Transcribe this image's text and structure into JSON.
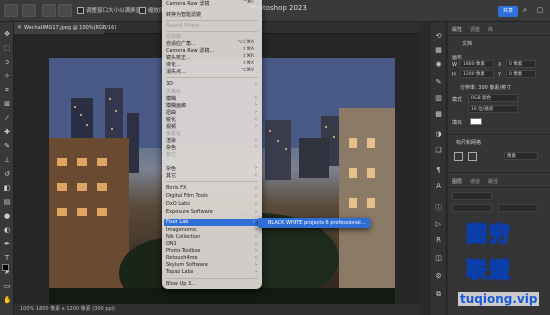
{
  "app": {
    "title": "Photoshop 2023"
  },
  "top_options": {
    "opt1": "调整窗口大小以满屏显示",
    "opt2": "缩放所有窗口",
    "share": "共享"
  },
  "document": {
    "tab": "WechatIMG17.jpeg @ 100%(RGB/16)",
    "status": "100%     1800 像素 x 1200 像素 (300 ppi)"
  },
  "filter_menu": {
    "items": [
      {
        "label": "Camera Raw 滤镜",
        "shortcut": "^⌘F"
      },
      {
        "label": "转换为智能滤镜"
      },
      {
        "label": "Neural Filters...",
        "disabled": true
      },
      {
        "label": "滤镜库...",
        "disabled": true
      },
      {
        "label": "自适应广角...",
        "shortcut": "⌥⇧⌘A"
      },
      {
        "label": "Camera Raw 滤镜...",
        "shortcut": "⇧⌘A"
      },
      {
        "label": "镜头校正...",
        "shortcut": "⇧⌘R"
      },
      {
        "label": "液化...",
        "shortcut": "⇧⌘X"
      },
      {
        "label": "消失点...",
        "shortcut": "⌥⌘V"
      },
      {
        "label": "3D"
      },
      {
        "label": "风格化",
        "disabled": true
      },
      {
        "label": "模糊"
      },
      {
        "label": "模糊画廊"
      },
      {
        "label": "扭曲"
      },
      {
        "label": "锐化"
      },
      {
        "label": "视频"
      },
      {
        "label": "像素化",
        "disabled": true
      },
      {
        "label": "渲染"
      },
      {
        "label": "杂色"
      },
      {
        "label": "其它",
        "disabled": true
      },
      {
        "label": "杂色"
      },
      {
        "label": "其它"
      },
      {
        "label": "Boris FX"
      },
      {
        "label": "Digital Film Tools"
      },
      {
        "label": "DxO Labs"
      },
      {
        "label": "Exposure Software"
      },
      {
        "label": "Fixer Lab",
        "highlighted": true
      },
      {
        "label": "Imagenomic"
      },
      {
        "label": "Nik Collection"
      },
      {
        "label": "ON1"
      },
      {
        "label": "Photo-Toolbox"
      },
      {
        "label": "Retouch4me"
      },
      {
        "label": "Skylum Software"
      },
      {
        "label": "Topaz Labs"
      },
      {
        "label": "Blow Up 3..."
      }
    ],
    "submenu_item": "BLACK WHITE projects 6 professional..."
  },
  "panel": {
    "tabs": [
      "属性",
      "调整",
      "库"
    ],
    "doc_label": "文档",
    "canvas_label": "画布",
    "w_label": "W",
    "w_value": "1800 像素",
    "h_label": "H",
    "h_value": "1200 像素",
    "x_label": "X",
    "x_value": "0 像素",
    "y_label": "Y",
    "y_value": "0 像素",
    "resolution": "分辨率: 300 像素/英寸",
    "mode_label": "模式",
    "mode_value": "RGB 颜色",
    "depth_value": "16 位/通道",
    "fill_label": "填充",
    "guides_label": "标尺和网格",
    "unit_value": "像素",
    "layers_tabs": [
      "图层",
      "通道",
      "路径"
    ]
  },
  "watermark": {
    "line1": "图穷",
    "line2": "联盟",
    "site": "tuqiong.vip"
  },
  "colors": {
    "accent": "#2f6ed6",
    "menu_bg": "#e0dad6",
    "panel_bg": "#353535"
  }
}
